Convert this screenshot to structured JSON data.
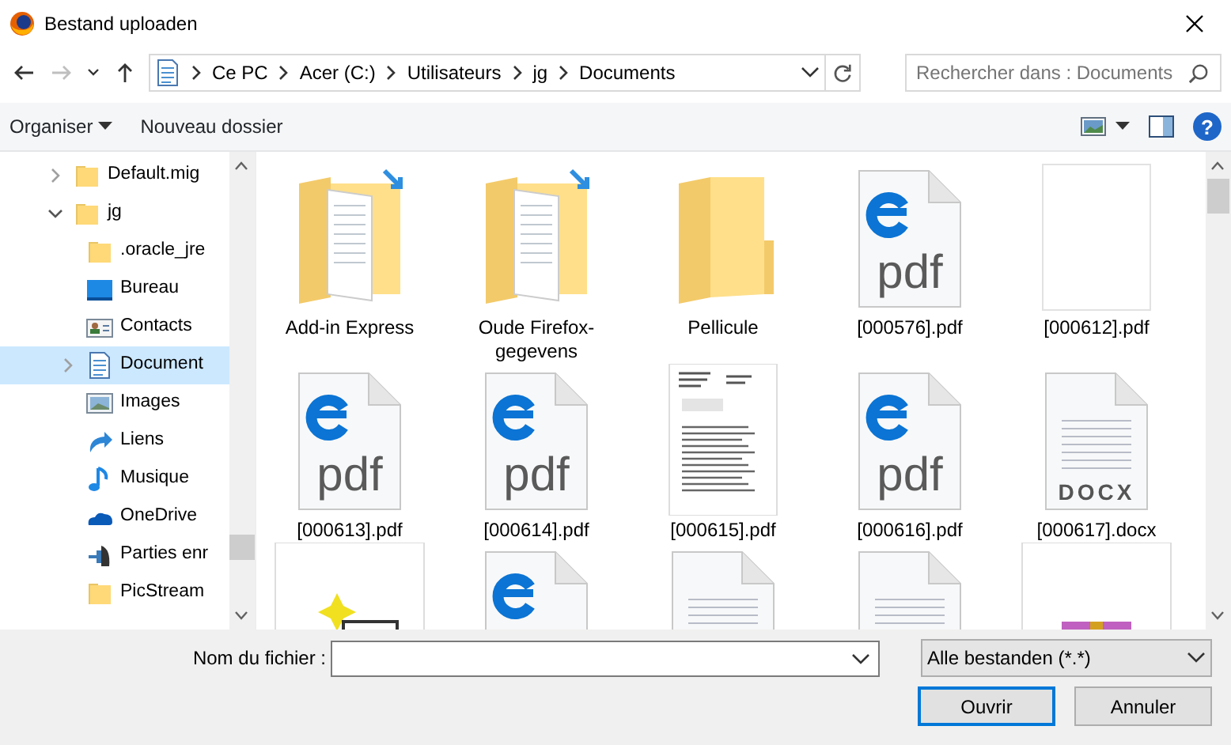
{
  "window": {
    "title": "Bestand uploaden"
  },
  "nav": [
    {
      "kind": "back",
      "disabled": false
    },
    {
      "kind": "forward",
      "disabled": true
    },
    {
      "kind": "recent",
      "disabled": false
    },
    {
      "kind": "up",
      "disabled": false
    }
  ],
  "address": {
    "crumbs": [
      "Ce PC",
      "Acer (C:)",
      "Utilisateurs",
      "jg",
      "Documents"
    ]
  },
  "search": {
    "placeholder": "Rechercher dans : Documents"
  },
  "toolbar": {
    "organize": "Organiser",
    "new_folder": "Nouveau dossier",
    "help": "?"
  },
  "sidebar": {
    "items": [
      {
        "label": "Default.mig",
        "kind": "folder",
        "expandable": true,
        "expanded": false,
        "selected": false
      },
      {
        "label": "jg",
        "kind": "folder",
        "expandable": true,
        "expanded": true,
        "selected": false,
        "children": [
          {
            "label": ".oracle_jre",
            "kind": "folder",
            "expandable": false,
            "expanded": false,
            "selected": false
          },
          {
            "label": "Bureau",
            "kind": "desktop",
            "expandable": false,
            "expanded": false,
            "selected": false
          },
          {
            "label": "Contacts",
            "kind": "contacts",
            "expandable": false,
            "expanded": false,
            "selected": false
          },
          {
            "label": "Document",
            "kind": "documents",
            "expandable": true,
            "expanded": false,
            "selected": true
          },
          {
            "label": "Images",
            "kind": "pictures",
            "expandable": false,
            "expanded": false,
            "selected": false
          },
          {
            "label": "Liens",
            "kind": "links",
            "expandable": false,
            "expanded": false,
            "selected": false
          },
          {
            "label": "Musique",
            "kind": "music",
            "expandable": false,
            "expanded": false,
            "selected": false
          },
          {
            "label": "OneDrive",
            "kind": "cloud",
            "expandable": false,
            "expanded": false,
            "selected": false
          },
          {
            "label": "Parties enr",
            "kind": "games",
            "expandable": false,
            "expanded": false,
            "selected": false
          },
          {
            "label": "PicStream",
            "kind": "folder",
            "expandable": false,
            "expanded": false,
            "selected": false
          }
        ]
      }
    ]
  },
  "files": [
    {
      "label": "Add-in Express",
      "kind": "folder_docs"
    },
    {
      "label": "Oude Firefox-gegevens",
      "kind": "folder_docs"
    },
    {
      "label": "Pellicule",
      "kind": "folder"
    },
    {
      "label": "[000576].pdf",
      "kind": "pdf",
      "icon_text": "pdf"
    },
    {
      "label": "[000612].pdf",
      "kind": "blank"
    },
    {
      "label": "[000613].pdf",
      "kind": "pdf",
      "icon_text": "pdf"
    },
    {
      "label": "[000614].pdf",
      "kind": "pdf",
      "icon_text": "pdf"
    },
    {
      "label": "[000615].pdf",
      "kind": "thumb"
    },
    {
      "label": "[000616].pdf",
      "kind": "pdf",
      "icon_text": "pdf"
    },
    {
      "label": "[000617].docx",
      "kind": "docx",
      "icon_text": "DOCX"
    },
    {
      "kind": "shortcut"
    },
    {
      "kind": "pdf"
    },
    {
      "kind": "doc"
    },
    {
      "kind": "doc"
    },
    {
      "kind": "archive"
    }
  ],
  "footer": {
    "filename_label": "Nom du fichier :",
    "filter": "Alle bestanden (*.*)",
    "buttons": [
      {
        "label": "Ouvrir",
        "default": true
      },
      {
        "label": "Annuler",
        "default": false
      }
    ]
  }
}
